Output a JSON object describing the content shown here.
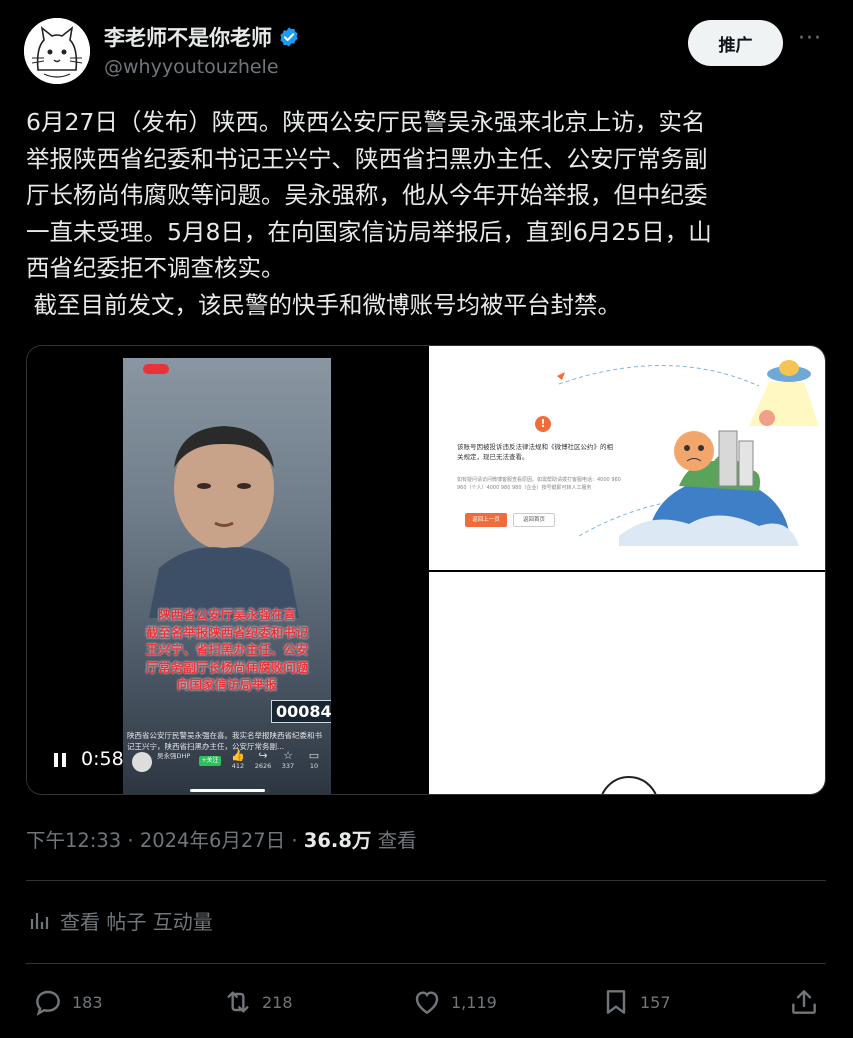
{
  "author": {
    "display_name": "李老师不是你老师",
    "handle": "@whyyoutouzhele",
    "verified": true,
    "avatar": "cat-sketch-avatar"
  },
  "header": {
    "promote_label": "推广",
    "more_icon": "more-dots-icon"
  },
  "tweet": {
    "text": "6月27日（发布）陕西。陕西公安厅民警吴永强来北京上访，实名\n举报陕西省纪委和书记王兴宁、陕西省扫黑办主任、公安厅常务副\n厅长杨尚伟腐败等问题。吴永强称，他从今年开始举报，但中纪委\n一直未受理。5月8日，在向国家信访局举报后，直到6月25日，山\n西省纪委拒不调查核实。\n 截至目前发文，该民警的快手和微博账号均被平台封禁。"
  },
  "video": {
    "time": "0:58",
    "overlay_text": "陕西省公安厅吴永强在喜\n截至名举报陕西省纪委和书记\n王兴宁、省扫黑办主任、公安\n厅常务副厅长杨尚伟腐败问题\n向国家信访局举报",
    "badge_number": "000849",
    "caption": "陕西省公安厅民警吴永强在喜。我实名举报陕西省纪委和书记王兴宁，陕西省扫黑办主任，公安厅常务副...",
    "channel_name": "吴永强DHP",
    "follow_label": "+关注",
    "stats": [
      {
        "icon": "thumb-up-icon",
        "value": "412"
      },
      {
        "icon": "share-icon",
        "value": "2626"
      },
      {
        "icon": "star-icon",
        "value": "337"
      },
      {
        "icon": "comment-icon",
        "value": "10"
      }
    ]
  },
  "error_page": {
    "title": "该账号因被投诉违反法律法规和《微博社区公约》的相关规定，现已无法查看。",
    "detail": "如有疑问请访问微博客服查看原因。如需帮助请拨打客服电话：4000 960 960（个人）4000 980 980（企业）按号键即可转人工服务",
    "back_label": "返回上一页",
    "home_label": "返回首页"
  },
  "meta": {
    "time": "下午12:33",
    "date": "2024年6月27日",
    "views": "36.8万",
    "views_label": "查看"
  },
  "analytics": {
    "label": "查看 帖子 互动量"
  },
  "actions": {
    "reply_count": "183",
    "retweet_count": "218",
    "like_count": "1,119",
    "bookmark_count": "157"
  },
  "colors": {
    "background": "#000000",
    "text": "#e7e9ea",
    "secondary": "#71767b",
    "verified": "#1d9bf0",
    "accent_orange": "#f26b3a"
  }
}
